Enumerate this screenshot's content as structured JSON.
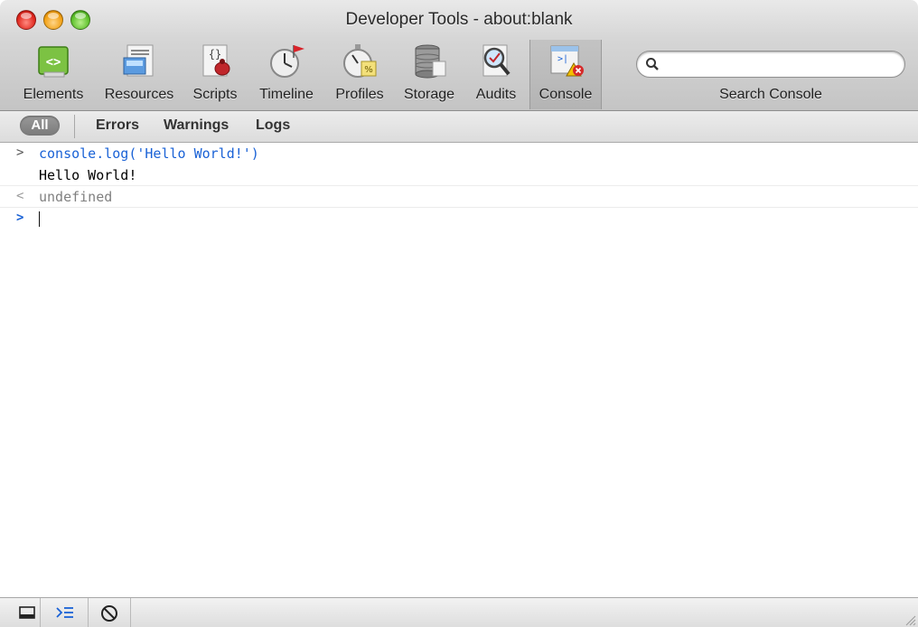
{
  "window": {
    "title": "Developer Tools - about:blank"
  },
  "toolbar": {
    "tabs": [
      {
        "label": "Elements",
        "icon": "elements-icon"
      },
      {
        "label": "Resources",
        "icon": "resources-icon"
      },
      {
        "label": "Scripts",
        "icon": "scripts-icon"
      },
      {
        "label": "Timeline",
        "icon": "timeline-icon"
      },
      {
        "label": "Profiles",
        "icon": "profiles-icon"
      },
      {
        "label": "Storage",
        "icon": "storage-icon"
      },
      {
        "label": "Audits",
        "icon": "audits-icon"
      },
      {
        "label": "Console",
        "icon": "console-icon",
        "active": true
      }
    ],
    "search": {
      "label": "Search Console",
      "value": "",
      "placeholder": ""
    }
  },
  "filter": {
    "all": "All",
    "errors": "Errors",
    "warnings": "Warnings",
    "logs": "Logs",
    "selected": "All"
  },
  "console": {
    "lines": [
      {
        "kind": "input",
        "prompt": ">",
        "text": "console.log('Hello World!')"
      },
      {
        "kind": "log",
        "prompt": "",
        "text": "Hello World!"
      },
      {
        "kind": "result",
        "prompt": "<",
        "text": "undefined"
      },
      {
        "kind": "prompt",
        "prompt": ">",
        "text": ""
      }
    ]
  },
  "colors": {
    "input_text": "#1a62d6",
    "prompt": "#1a62d6",
    "result_text": "#808080",
    "log_text": "#000000"
  },
  "statusbar": {
    "buttons": [
      "dock-icon",
      "console-toggle-icon",
      "clear-icon"
    ]
  }
}
